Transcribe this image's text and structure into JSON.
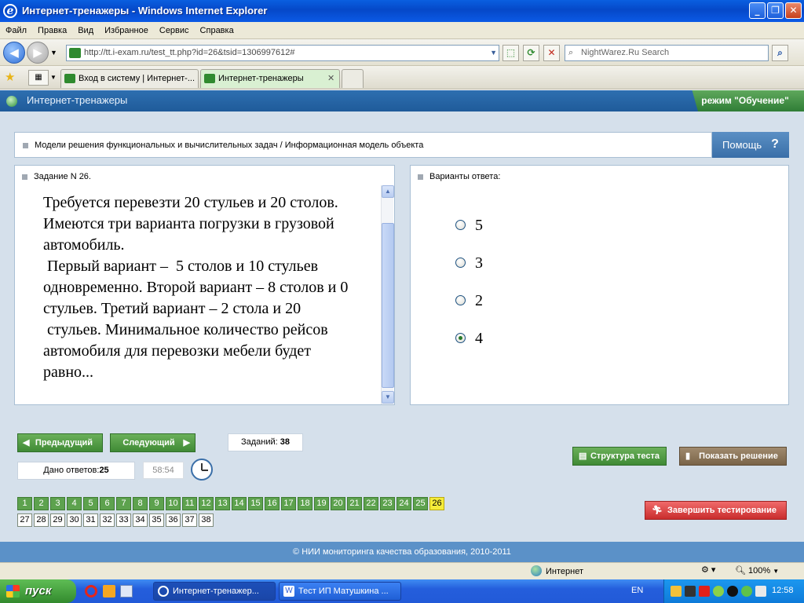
{
  "window": {
    "title": "Интернет-тренажеры - Windows Internet Explorer"
  },
  "menu": [
    "Файл",
    "Правка",
    "Вид",
    "Избранное",
    "Сервис",
    "Справка"
  ],
  "address": {
    "url": "http://tt.i-exam.ru/test_tt.php?id=26&tsid=1306997612#",
    "search_placeholder": "NightWarez.Ru Search"
  },
  "tabs": [
    {
      "label": "Вход в систему | Интернет-..."
    },
    {
      "label": "Интернет-тренажеры"
    }
  ],
  "site": {
    "name": "Интернет-тренажеры",
    "mode": "режим \"Обучение\""
  },
  "topic": "Модели решения функциональных и вычислительных задач / Информационная модель объекта",
  "help_label": "Помощь",
  "task": {
    "header": "Задание N 26.",
    "text": "Требуется перевезти 20 стульев и 20 столов. Имеются три варианта погрузки в грузовой автомобиль.\n Первый вариант –  5 столов и 10 стульев одновременно. Второй вариант – 8 столов и 0 стульев. Третий вариант – 2 стола и 20\n стульев. Минимальное количество рейсов автомобиля для перевозки мебели будет равно..."
  },
  "answers": {
    "header": "Варианты ответа:",
    "options": [
      "5",
      "3",
      "2",
      "4"
    ],
    "selected_index": 3
  },
  "controls": {
    "prev_label": "Предыдущий",
    "next_label": "Следующий",
    "tasks_label": "Заданий:",
    "tasks_count": "38",
    "answered_label": "Дано ответов:",
    "answered_count": "25",
    "timer": "58:54",
    "structure_label": "Структура теста",
    "solution_label": "Показать решение",
    "finish_label": "Завершить тестирование"
  },
  "questions": {
    "total": 38,
    "current": 26,
    "answered_up_to": 25
  },
  "footer": "© НИИ мониторинга качества образования, 2010-2011",
  "status": {
    "zone": "Интернет",
    "zoom": "100%"
  },
  "taskbar": {
    "start_label": "пуск",
    "windows": [
      "Интернет-тренажер...",
      "Тест ИП Матушкина ..."
    ],
    "lang": "EN",
    "time": "12:58"
  },
  "colors": {
    "site_blue": "#2e6fb0",
    "green_button": "#3f8a35",
    "current_task": "#f5ec3a",
    "finish_red": "#c92d2d"
  }
}
